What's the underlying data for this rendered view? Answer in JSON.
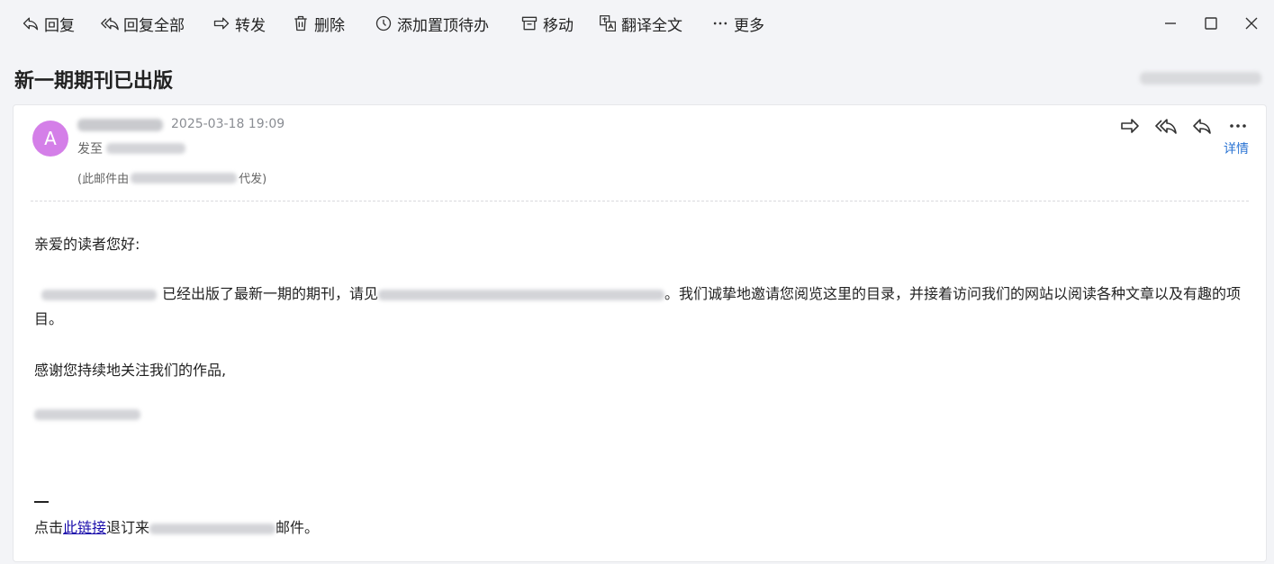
{
  "toolbar": {
    "reply": "回复",
    "reply_all": "回复全部",
    "forward": "转发",
    "delete": "删除",
    "todo": "添加置顶待办",
    "move": "移动",
    "translate": "翻译全文",
    "more": "更多"
  },
  "email": {
    "subject": "新一期期刊已出版",
    "avatar_letter": "A",
    "date": "2025-03-18 19:09",
    "to_prefix": "发至",
    "proxy_prefix": "(此邮件由",
    "proxy_suffix": "代发)",
    "detail": "详情"
  },
  "body": {
    "greeting": "亲爱的读者您好:",
    "para_part1": "已经出版了最新一期的期刊，请见",
    "para_part2": "。我们诚挚地邀请您阅览这里的目录，并接着访问我们的网站以阅读各种文章以及有趣的项目。",
    "thanks": "感谢您持续地关注我们的作品,",
    "unsub_prefix": "点击",
    "unsub_link": "此链接",
    "unsub_mid": "退订来",
    "unsub_suffix": "邮件。"
  },
  "icons": [
    "reply-icon",
    "reply-all-icon",
    "forward-icon",
    "trash-icon",
    "clock-icon",
    "archive-icon",
    "translate-icon",
    "more-icon",
    "minimize-icon",
    "maximize-icon",
    "close-icon"
  ],
  "colors": {
    "avatar": "#d47fe8",
    "link": "#2a73d3"
  }
}
